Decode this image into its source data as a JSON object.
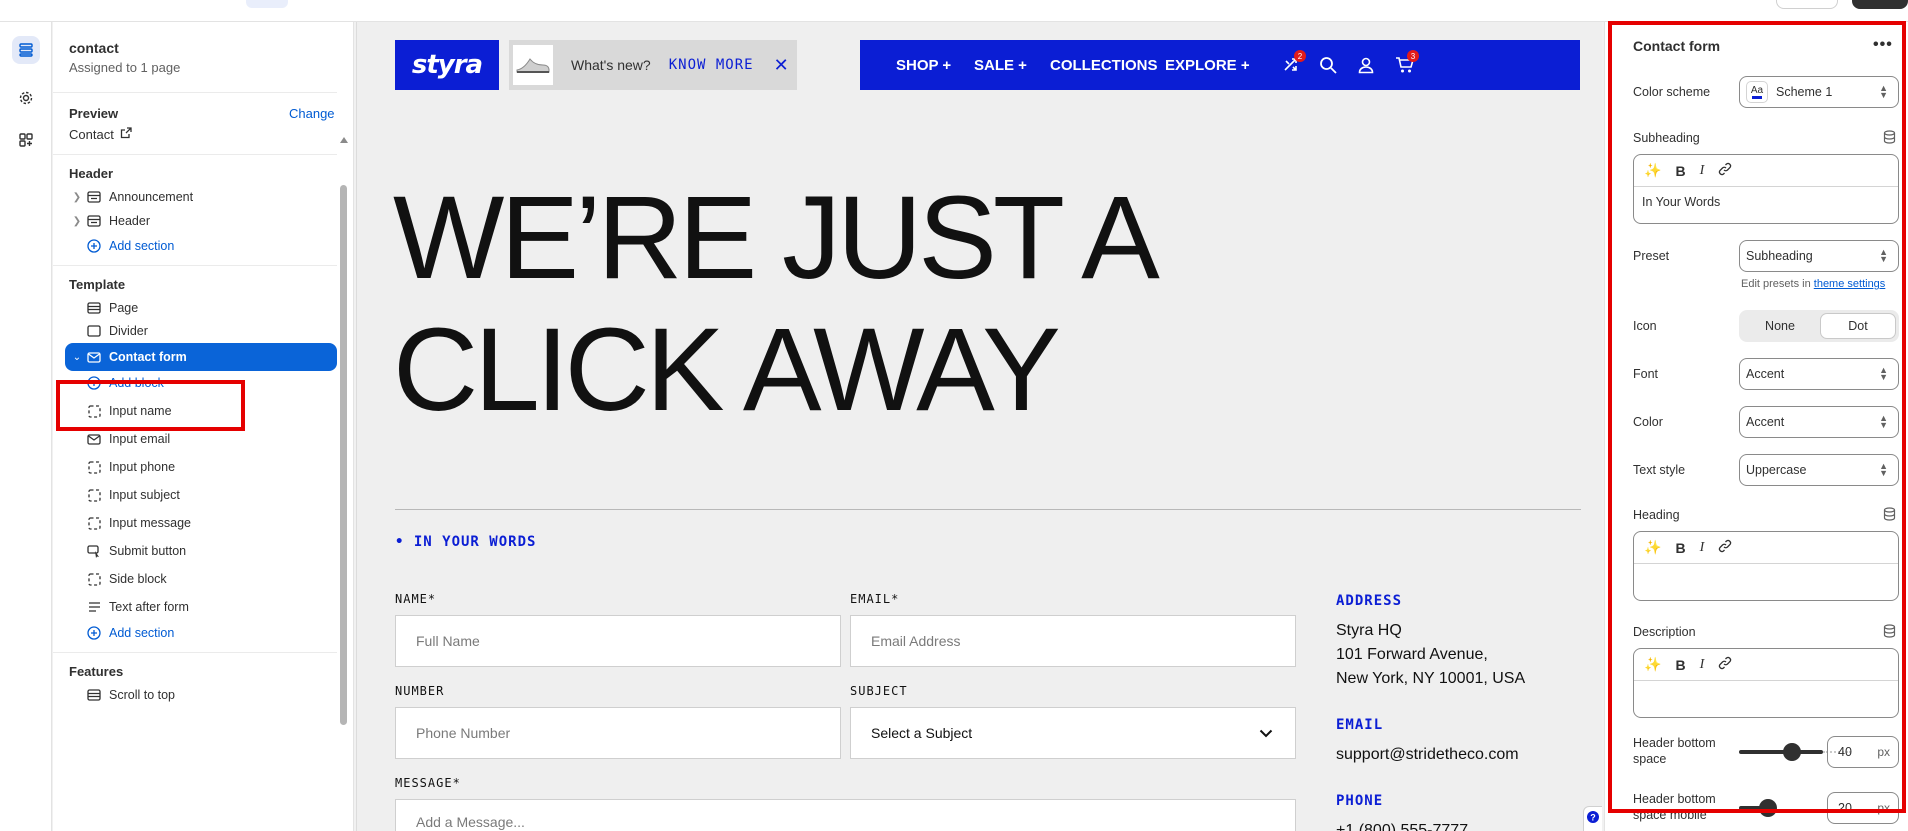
{
  "left_panel": {
    "page_name": "contact",
    "assigned": "Assigned to 1 page",
    "preview_label": "Preview",
    "change_label": "Change",
    "preview_page": "Contact",
    "header_group": "Header",
    "header_items": [
      "Announcement",
      "Header"
    ],
    "add_section": "Add section",
    "template_group": "Template",
    "template_items": [
      "Page",
      "Divider"
    ],
    "selected_section": "Contact form",
    "add_block": "Add block",
    "blocks": [
      "Input name",
      "Input email",
      "Input phone",
      "Input subject",
      "Input message",
      "Submit button",
      "Side block",
      "Text after form"
    ],
    "add_section_2": "Add section",
    "features_group": "Features",
    "features_items": [
      "Scroll to top"
    ]
  },
  "preview": {
    "logo": "styra",
    "announcement": {
      "question": "What's new?",
      "cta": "KNOW MORE"
    },
    "nav": [
      "SHOP +",
      "SALE +",
      "COLLECTIONS",
      "EXPLORE +"
    ],
    "badges": {
      "compare": "2",
      "cart": "3"
    },
    "hero_lines": [
      "WE’RE JUST A",
      "CLICK AWAY"
    ],
    "eyebrow": "IN YOUR WORDS",
    "form": {
      "name_label": "NAME*",
      "name_placeholder": "Full Name",
      "email_label": "EMAIL*",
      "email_placeholder": "Email Address",
      "number_label": "NUMBER",
      "number_placeholder": "Phone Number",
      "subject_label": "SUBJECT",
      "subject_value": "Select a Subject",
      "message_label": "MESSAGE*",
      "message_placeholder": "Add a Message..."
    },
    "aside": {
      "address_h": "ADDRESS",
      "address_lines": [
        "Styra HQ",
        "101 Forward Avenue,",
        "New York, NY 10001, USA"
      ],
      "email_h": "EMAIL",
      "email": "support@stridetheco.com",
      "phone_h": "PHONE",
      "phone": "+1 (800) 555-7777"
    }
  },
  "right_panel": {
    "title": "Contact form",
    "color_scheme_label": "Color scheme",
    "color_scheme_value": "Scheme 1",
    "subheading_label": "Subheading",
    "subheading_value": "In Your Words",
    "preset_label": "Preset",
    "preset_value": "Subheading",
    "hint_text": "Edit presets in",
    "hint_link": "theme settings",
    "icon_label": "Icon",
    "icon_options": [
      "None",
      "Dot"
    ],
    "icon_selected": "Dot",
    "font_label": "Font",
    "font_value": "Accent",
    "color_label": "Color",
    "color_value": "Accent",
    "text_style_label": "Text style",
    "text_style_value": "Uppercase",
    "heading_label": "Heading",
    "description_label": "Description",
    "header_bottom_label": "Header bottom space",
    "header_bottom_value": "40",
    "header_bottom_mobile_label": "Header bottom space mobile",
    "header_bottom_mobile_value": "20",
    "unit": "px"
  },
  "colors": {
    "brand": "#0b1ed4",
    "accent": "#005bd3",
    "selected": "#0a64d8",
    "highlight": "#e50000"
  }
}
